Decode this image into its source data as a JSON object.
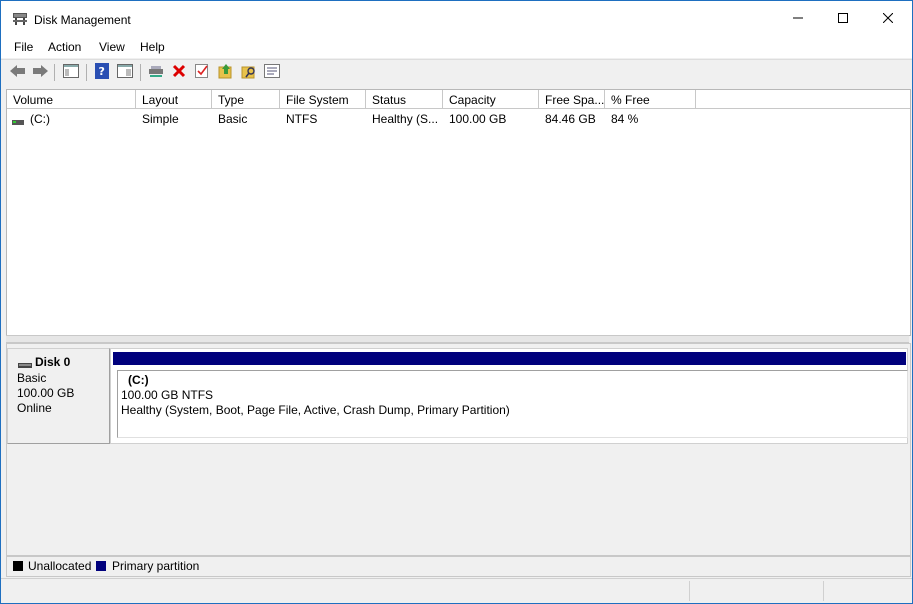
{
  "window": {
    "title": "Disk Management",
    "icons": {
      "app": "disk-management-icon",
      "minimize": "minimize-icon",
      "maximize": "maximize-icon",
      "close": "close-icon"
    }
  },
  "menu": [
    "File",
    "Action",
    "View",
    "Help"
  ],
  "toolbar": {
    "icons": [
      "back-arrow-icon",
      "forward-arrow-icon",
      "console-tree-icon",
      "help-icon",
      "properties-icon",
      "connect-disk-icon",
      "delete-icon",
      "check-icon",
      "open-folder-icon",
      "explore-folder-icon",
      "list-view-icon"
    ]
  },
  "volume_list": {
    "columns": [
      "Volume",
      "Layout",
      "Type",
      "File System",
      "Status",
      "Capacity",
      "Free Spa...",
      "% Free"
    ],
    "rows": [
      {
        "volume": "(C:)",
        "layout": "Simple",
        "type": "Basic",
        "file_system": "NTFS",
        "status": "Healthy (S...",
        "capacity": "100.00 GB",
        "free_space": "84.46 GB",
        "percent_free": "84 %"
      }
    ]
  },
  "disks": [
    {
      "name": "Disk 0",
      "type": "Basic",
      "size": "100.00 GB",
      "state": "Online",
      "partitions": [
        {
          "label": "(C:)",
          "size_fs": "100.00 GB NTFS",
          "status": "Healthy (System, Boot, Page File, Active, Crash Dump, Primary Partition)"
        }
      ]
    }
  ],
  "legend": [
    {
      "label": "Unallocated",
      "color": "#000000"
    },
    {
      "label": "Primary partition",
      "color": "#00007c"
    }
  ],
  "colors": {
    "primary_partition": "#00007c",
    "window_border": "#1e6fc0"
  }
}
